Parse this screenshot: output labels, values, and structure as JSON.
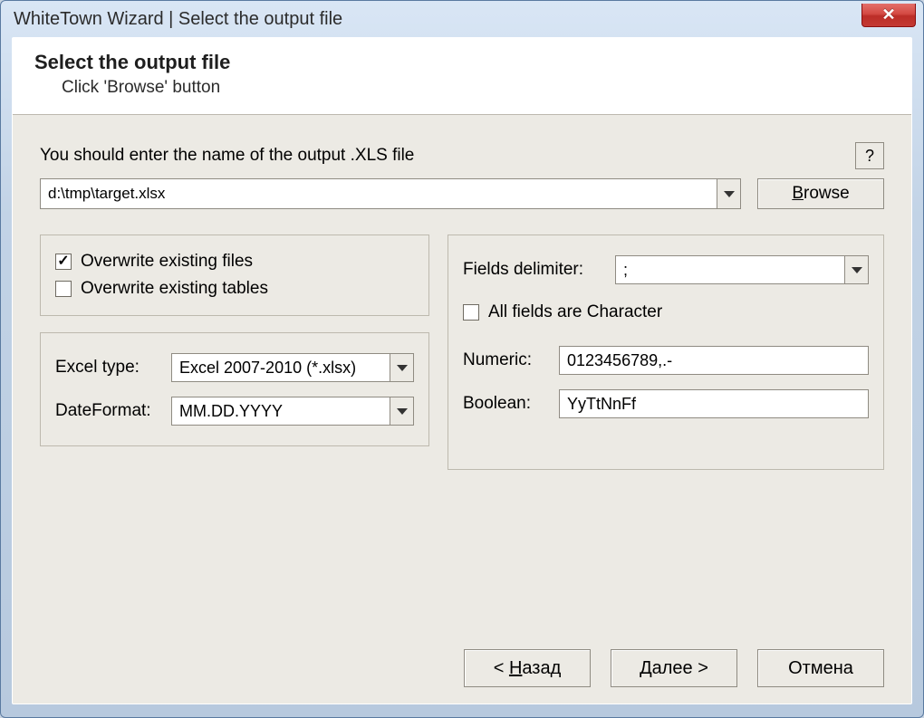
{
  "titlebar": {
    "title": "WhiteTown Wizard | Select the output file"
  },
  "banner": {
    "heading": "Select the output file",
    "sub": "Click 'Browse' button"
  },
  "main": {
    "hint": "You should enter the name of the output .XLS file",
    "help": "?",
    "file_value": "d:\\tmp\\target.xlsx",
    "browse_label": "Browse"
  },
  "left": {
    "overwrite_files": {
      "label": "Overwrite existing files",
      "checked": true
    },
    "overwrite_tables": {
      "label": "Overwrite existing tables",
      "checked": false
    },
    "excel_type_label": "Excel type:",
    "excel_type_value": "Excel 2007-2010 (*.xlsx)",
    "date_format_label": "DateFormat:",
    "date_format_value": "MM.DD.YYYY"
  },
  "right": {
    "fields_delim_label": "Fields delimiter:",
    "fields_delim_value": ";",
    "all_char": {
      "label": "All fields are Character",
      "checked": false
    },
    "numeric_label": "Numeric:",
    "numeric_value": "0123456789,.-",
    "boolean_label": "Boolean:",
    "boolean_value": "YyTtNnFf"
  },
  "footer": {
    "back": "< Назад",
    "next": "Далее >",
    "cancel": "Отмена"
  }
}
